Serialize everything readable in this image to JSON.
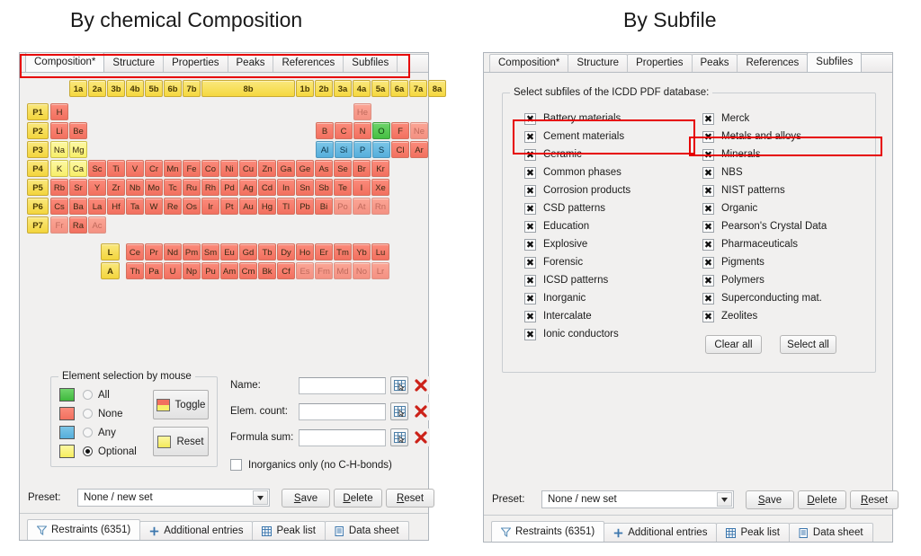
{
  "titles": {
    "left": "By chemical Composition",
    "right": "By Subfile"
  },
  "colors": {
    "annotation": "#e60000",
    "all": "#45bf43",
    "none": "#f2705f",
    "any": "#56aedb",
    "optional": "#f7ef6a",
    "group_header": "#f5d83f"
  },
  "tabs": {
    "labels": [
      "Composition*",
      "Structure",
      "Properties",
      "Peaks",
      "References",
      "Subfiles"
    ],
    "left_active": "Composition*",
    "right_active": "Subfiles"
  },
  "periodic_table": {
    "group_headers": [
      "1a",
      "2a",
      "3b",
      "4b",
      "5b",
      "6b",
      "7b",
      "8b",
      "1b",
      "2b",
      "3a",
      "4a",
      "5a",
      "6a",
      "7a",
      "8a"
    ],
    "period_labels": [
      "P1",
      "P2",
      "P3",
      "P4",
      "P5",
      "P6",
      "P7"
    ],
    "lan_label": "L",
    "act_label": "A",
    "rows": {
      "P1": [
        "H",
        "He"
      ],
      "P2": [
        "Li",
        "Be",
        "B",
        "C",
        "N",
        "O",
        "F",
        "Ne"
      ],
      "P3": [
        "Na",
        "Mg",
        "Al",
        "Si",
        "P",
        "S",
        "Cl",
        "Ar"
      ],
      "P4": [
        "K",
        "Ca",
        "Sc",
        "Ti",
        "V",
        "Cr",
        "Mn",
        "Fe",
        "Co",
        "Ni",
        "Cu",
        "Zn",
        "Ga",
        "Ge",
        "As",
        "Se",
        "Br",
        "Kr"
      ],
      "P5": [
        "Rb",
        "Sr",
        "Y",
        "Zr",
        "Nb",
        "Mo",
        "Tc",
        "Ru",
        "Rh",
        "Pd",
        "Ag",
        "Cd",
        "In",
        "Sn",
        "Sb",
        "Te",
        "I",
        "Xe"
      ],
      "P6": [
        "Cs",
        "Ba",
        "La",
        "Hf",
        "Ta",
        "W",
        "Re",
        "Os",
        "Ir",
        "Pt",
        "Au",
        "Hg",
        "Tl",
        "Pb",
        "Bi",
        "Po",
        "At",
        "Rn"
      ],
      "P7": [
        "Fr",
        "Ra",
        "Ac"
      ],
      "L": [
        "Ce",
        "Pr",
        "Nd",
        "Pm",
        "Sm",
        "Eu",
        "Gd",
        "Tb",
        "Dy",
        "Ho",
        "Er",
        "Tm",
        "Yb",
        "Lu"
      ],
      "A": [
        "Th",
        "Pa",
        "U",
        "Np",
        "Pu",
        "Am",
        "Cm",
        "Bk",
        "Cf",
        "Es",
        "Fm",
        "Md",
        "No",
        "Lr"
      ]
    }
  },
  "element_selection": {
    "title": "Element selection by mouse",
    "options": [
      {
        "label": "All",
        "selected": false
      },
      {
        "label": "None",
        "selected": false
      },
      {
        "label": "Any",
        "selected": false
      },
      {
        "label": "Optional",
        "selected": true
      }
    ],
    "toggle_button": "Toggle",
    "reset_button": "Reset"
  },
  "fields": {
    "name": {
      "label": "Name:",
      "value": "",
      "placeholder": ""
    },
    "elem_count": {
      "label": "Elem. count:",
      "value": "",
      "placeholder": ""
    },
    "formula_sum": {
      "label": "Formula sum:",
      "value": "",
      "placeholder": ""
    },
    "inorganics_checkbox": {
      "label": "Inorganics only (no C-H-bonds)",
      "checked": false
    },
    "picker_icon": "table-picker-icon",
    "clear_icon": "red-x-icon"
  },
  "subfiles": {
    "groupbox_title": "Select subfiles of the ICDD PDF database:",
    "column1": [
      {
        "label": "Battery materials",
        "checked": true
      },
      {
        "label": "Cement materials",
        "checked": true
      },
      {
        "label": "Ceramic",
        "checked": true
      },
      {
        "label": "Common phases",
        "checked": true
      },
      {
        "label": "Corrosion products",
        "checked": true
      },
      {
        "label": "CSD patterns",
        "checked": true
      },
      {
        "label": "Education",
        "checked": true
      },
      {
        "label": "Explosive",
        "checked": true
      },
      {
        "label": "Forensic",
        "checked": true
      },
      {
        "label": "ICSD patterns",
        "checked": true
      },
      {
        "label": "Inorganic",
        "checked": true
      },
      {
        "label": "Intercalate",
        "checked": true
      },
      {
        "label": "Ionic conductors",
        "checked": true
      }
    ],
    "column2": [
      {
        "label": "Merck",
        "checked": true
      },
      {
        "label": "Metals and alloys",
        "checked": true
      },
      {
        "label": "Minerals",
        "checked": true
      },
      {
        "label": "NBS",
        "checked": true
      },
      {
        "label": "NIST patterns",
        "checked": true
      },
      {
        "label": "Organic",
        "checked": true
      },
      {
        "label": "Pearson's Crystal Data",
        "checked": true
      },
      {
        "label": "Pharmaceuticals",
        "checked": true
      },
      {
        "label": "Pigments",
        "checked": true
      },
      {
        "label": "Polymers",
        "checked": true
      },
      {
        "label": "Superconducting mat.",
        "checked": true
      },
      {
        "label": "Zeolites",
        "checked": true
      }
    ],
    "clear_all": "Clear all",
    "select_all": "Select all"
  },
  "preset": {
    "label": "Preset:",
    "value": "None / new set",
    "save": "Save",
    "delete": "Delete",
    "reset": "Reset"
  },
  "bottom_tabs": [
    {
      "label": "Restraints (6351)",
      "icon": "funnel-icon",
      "active": true
    },
    {
      "label": "Additional entries",
      "icon": "plus-icon",
      "active": false
    },
    {
      "label": "Peak list",
      "icon": "grid-icon",
      "active": false
    },
    {
      "label": "Data sheet",
      "icon": "document-icon",
      "active": false
    }
  ]
}
